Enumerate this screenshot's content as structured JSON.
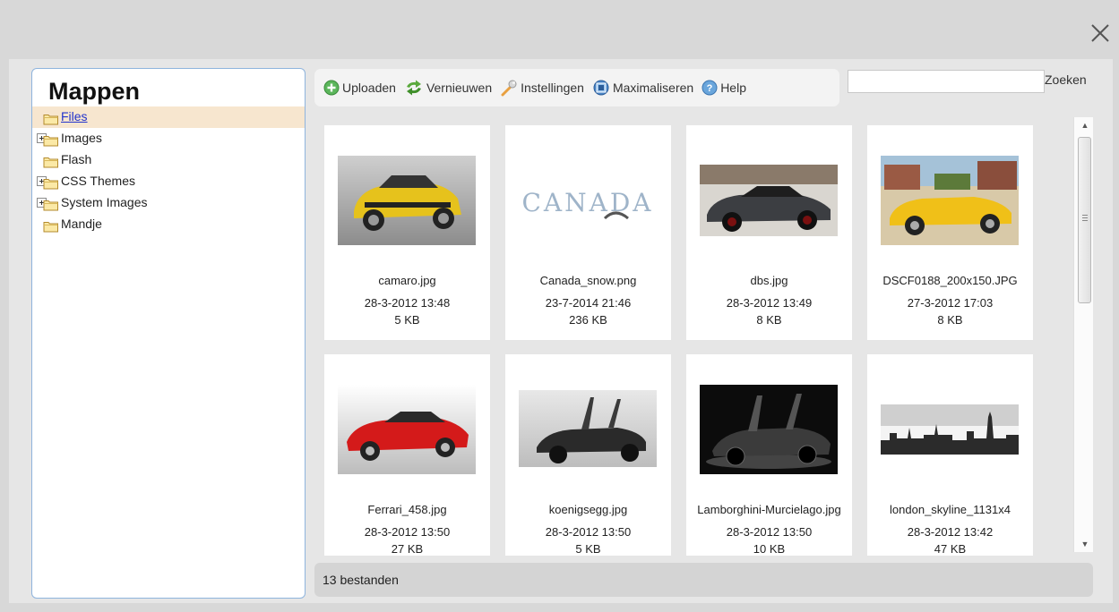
{
  "dialog": {
    "close_icon": "close-x-icon"
  },
  "folders": {
    "title": "Mappen",
    "items": [
      {
        "label": "Files",
        "expandable": false,
        "selected": true
      },
      {
        "label": "Images",
        "expandable": true,
        "selected": false
      },
      {
        "label": "Flash",
        "expandable": false,
        "selected": false
      },
      {
        "label": "CSS Themes",
        "expandable": true,
        "selected": false
      },
      {
        "label": "System Images",
        "expandable": true,
        "selected": false
      },
      {
        "label": "Mandje",
        "expandable": false,
        "selected": false
      }
    ]
  },
  "toolbar": {
    "upload": {
      "label": "Uploaden",
      "icon": "upload-plus-icon"
    },
    "refresh": {
      "label": "Vernieuwen",
      "icon": "refresh-arrows-icon"
    },
    "settings": {
      "label": "Instellingen",
      "icon": "wrench-icon"
    },
    "maximize": {
      "label": "Maximaliseren",
      "icon": "maximize-icon"
    },
    "help": {
      "label": "Help",
      "icon": "help-icon"
    }
  },
  "search": {
    "value": "",
    "button_label": "Zoeken"
  },
  "files": [
    {
      "name": "camaro.jpg",
      "date": "28-3-2012 13:48",
      "size": "5 KB",
      "thumb": "yellow-car"
    },
    {
      "name": "Canada_snow.png",
      "date": "23-7-2014 21:46",
      "size": "236 KB",
      "thumb": "canada-text"
    },
    {
      "name": "dbs.jpg",
      "date": "28-3-2012 13:49",
      "size": "8 KB",
      "thumb": "grey-car"
    },
    {
      "name": "DSCF0188_200x150.JPG",
      "date": "27-3-2012 17:03",
      "size": "8 KB",
      "thumb": "yellow-roadster"
    },
    {
      "name": "Ferrari_458.jpg",
      "date": "28-3-2012 13:50",
      "size": "27 KB",
      "thumb": "red-car"
    },
    {
      "name": "koenigsegg.jpg",
      "date": "28-3-2012 13:50",
      "size": "5 KB",
      "thumb": "black-supercar"
    },
    {
      "name": "Lamborghini-Murcielago.jpg",
      "date": "28-3-2012 13:50",
      "size": "10 KB",
      "thumb": "lambo"
    },
    {
      "name": "london_skyline_1131x4",
      "date": "28-3-2012 13:42",
      "size": "47 KB",
      "thumb": "skyline"
    }
  ],
  "status": {
    "text": "13 bestanden"
  },
  "colors": {
    "selected_row": "#f7e6cf",
    "link": "#2233cc",
    "pane_border": "#8fb4dd"
  }
}
